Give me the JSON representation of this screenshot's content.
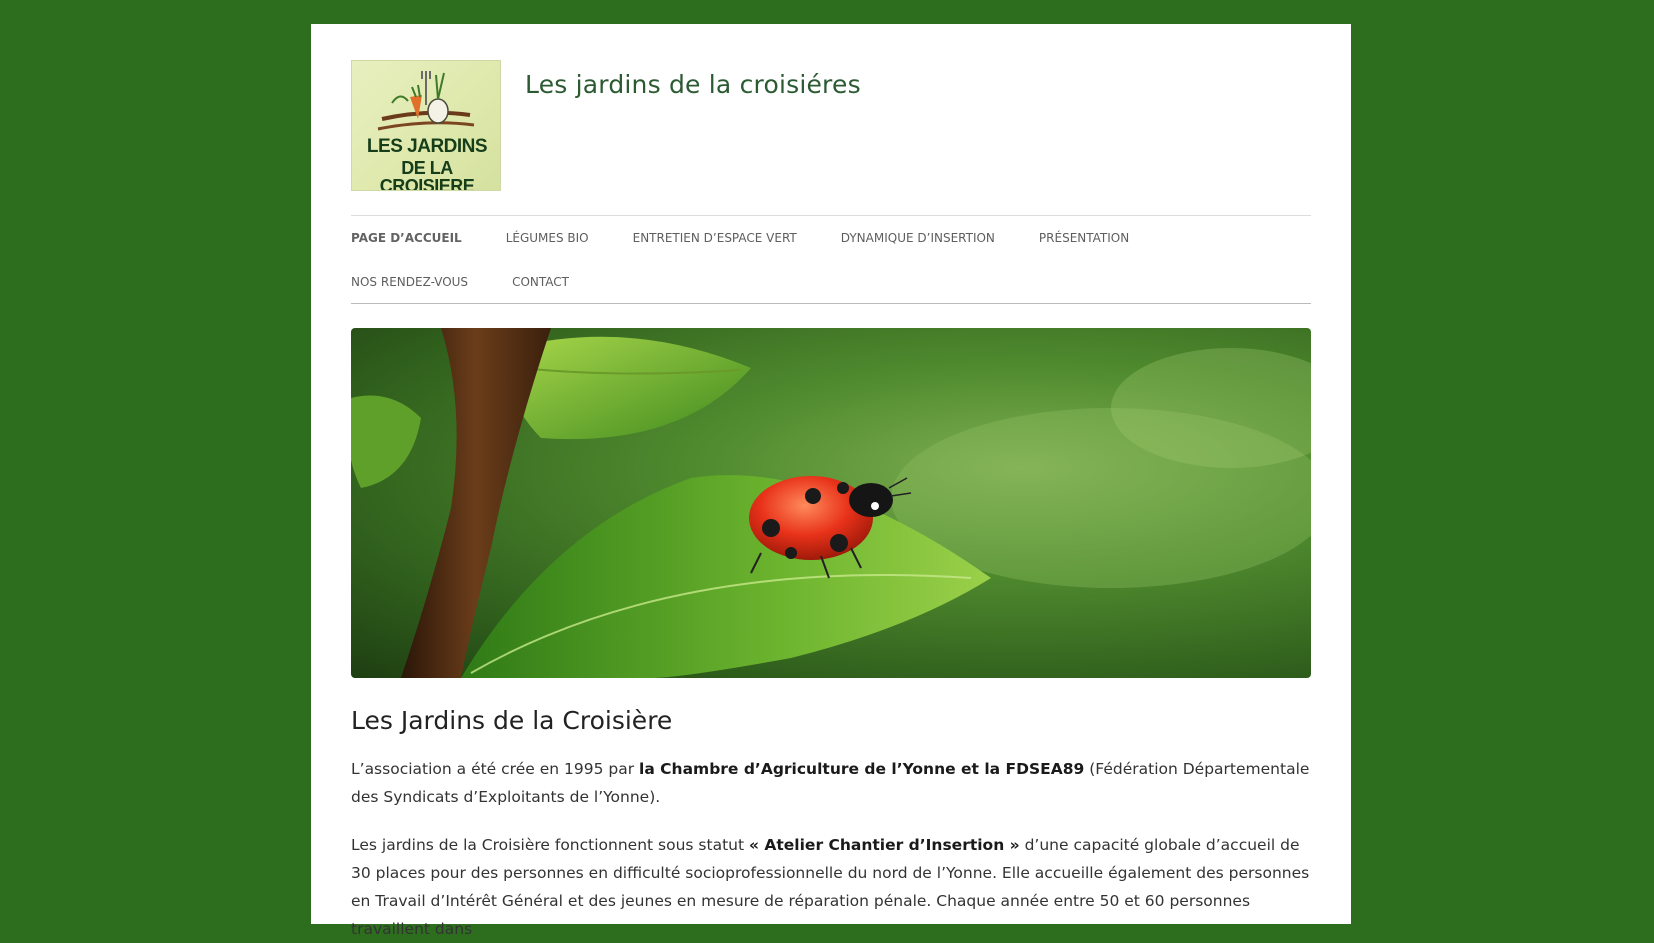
{
  "site": {
    "title": "Les jardins de la croisiéres",
    "logo_line1": "LES JARDINS",
    "logo_line2": "DE LA CROISIERE"
  },
  "nav": {
    "items": [
      {
        "label": "Page d’accueil"
      },
      {
        "label": "Légumes Bio"
      },
      {
        "label": "Entretien d’espace vert"
      },
      {
        "label": "Dynamique d’insertion"
      },
      {
        "label": "Présentation"
      },
      {
        "label": "Nos rendez-vous"
      },
      {
        "label": "Contact"
      }
    ]
  },
  "content": {
    "title": "Les Jardins de la Croisière",
    "p1_a": "L’association a été crée en 1995 par ",
    "p1_b": "la Chambre d’Agriculture de l’Yonne et la FDSEA89",
    "p1_c": " (Fédération Départementale des Syndicats d’Exploitants de l’Yonne).",
    "p2_a": "Les jardins de la Croisière fonctionnent sous statut ",
    "p2_b": "« Atelier Chantier d’Insertion »",
    "p2_c": " d’une capacité globale d’accueil de 30 places pour des personnes en difficulté socioprofessionnelle du nord de l’Yonne. Elle accueille également des personnes en Travail d’Intérêt Général et des jeunes en mesure de réparation pénale. Chaque année entre 50 et 60 personnes travaillent dans"
  },
  "colors": {
    "background": "#2d6e1e",
    "title": "#2b5a33"
  }
}
